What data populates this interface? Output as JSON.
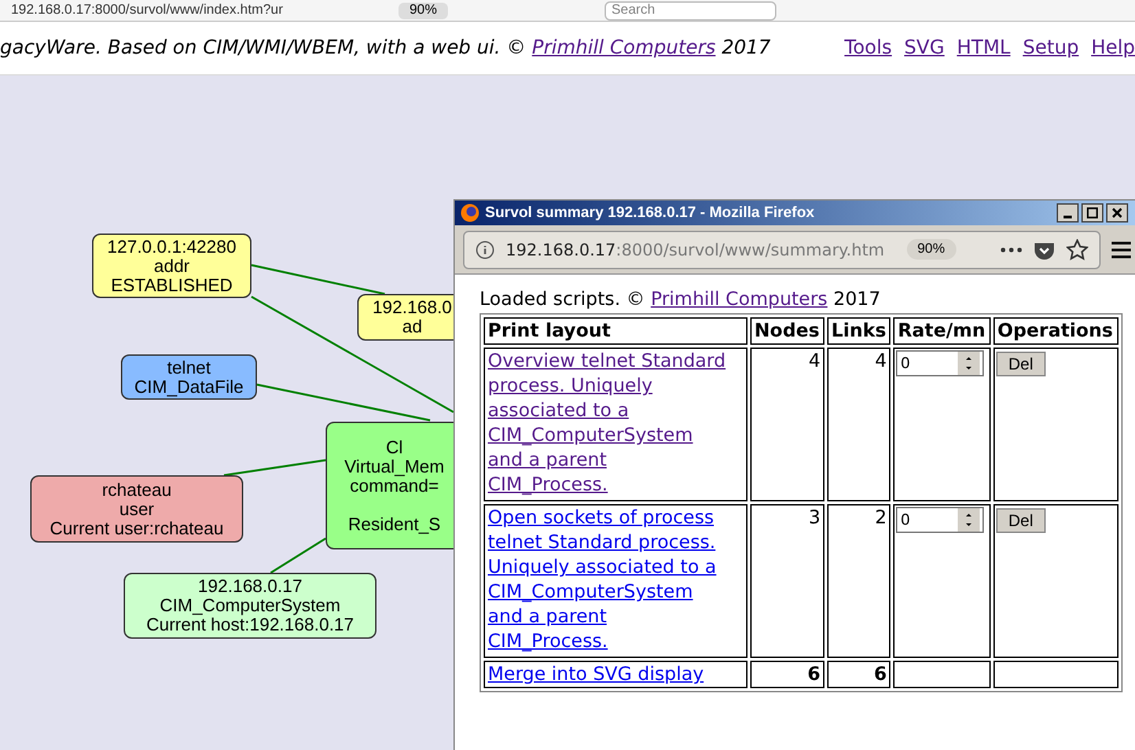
{
  "browser_toolbar": {
    "url": "192.168.0.17:8000/survol/www/index.htm?ur",
    "zoom": "90%",
    "search": {
      "placeholder": "Search"
    }
  },
  "header": {
    "text": "gacyWare. Based on CIM/WMI/WBEM, with a web ui. ©",
    "link": "Primhill Computers",
    "year": "2017",
    "nav": [
      "Tools",
      "SVG",
      "HTML",
      "Setup",
      "Help"
    ]
  },
  "graph": {
    "nodes": [
      {
        "lines": [
          "127.0.0.1:42280",
          "addr",
          "ESTABLISHED"
        ],
        "color": "#ffff99"
      },
      {
        "lines": [
          "192.168.0",
          "ad"
        ],
        "color": "#ffff99"
      },
      {
        "lines": [
          "telnet",
          "CIM_DataFile"
        ],
        "color": "#88bbff"
      },
      {
        "lines": [
          "rchateau",
          "user",
          "Current user:rchateau"
        ],
        "color": "#eeaaaa"
      },
      {
        "lines": [
          "Cl",
          "Virtual_Mem",
          "command="
        ],
        "footer": "Resident_S",
        "color": "#99ff88"
      },
      {
        "lines": [
          "192.168.0.17",
          "CIM_ComputerSystem",
          "Current host:192.168.0.17"
        ],
        "color": "#ccffcc"
      }
    ]
  },
  "popup": {
    "title": "Survol summary 192.168.0.17 - Mozilla Firefox",
    "url": {
      "host": "192.168.0.17",
      "path": ":8000/survol/www/summary.htm"
    },
    "zoom": "90%",
    "intro": "Loaded scripts. ©",
    "link": "Primhill Computers",
    "year": "2017",
    "table": {
      "columns": [
        "Print layout",
        "Nodes",
        "Links",
        "Rate/mn",
        "Operations"
      ],
      "rows": [
        {
          "layout": "Overview telnet Standard process. Uniquely associated to a CIM_ComputerSystem and a parent CIM_Process.",
          "visited": true,
          "nodes": "4",
          "links": "4",
          "rate": "0",
          "operation": "Del"
        },
        {
          "layout": "Open sockets of process telnet Standard process. Uniquely associated to a CIM_ComputerSystem and a parent CIM_Process.",
          "visited": false,
          "nodes": "3",
          "links": "2",
          "rate": "0",
          "operation": "Del"
        }
      ],
      "total": {
        "layout": "Merge into SVG display",
        "nodes": "6",
        "links": "6"
      }
    }
  }
}
